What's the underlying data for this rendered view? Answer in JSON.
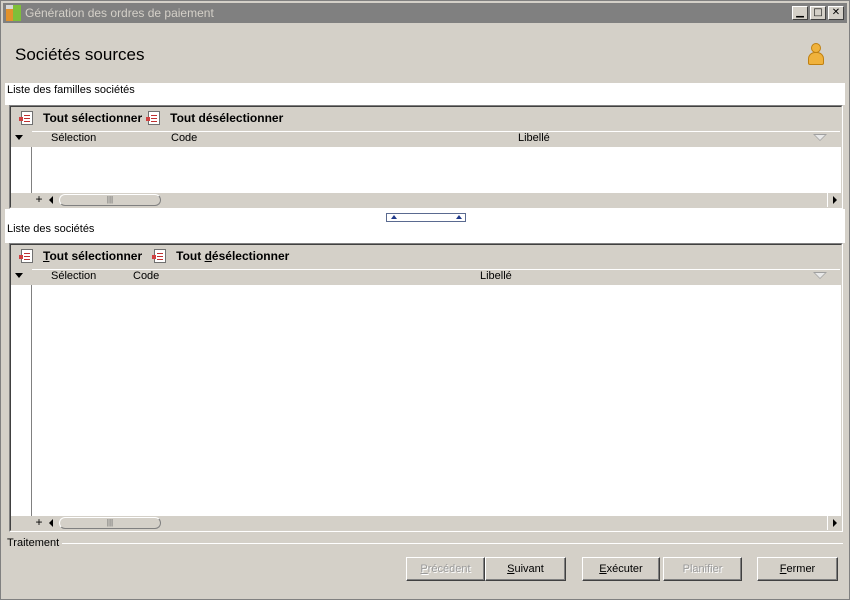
{
  "window": {
    "title": "Génération des ordres de paiement",
    "controls": {
      "minimize": "▁",
      "maximize": "□",
      "close": "✕"
    }
  },
  "header": {
    "title": "Sociétés sources"
  },
  "families": {
    "group_label": "Liste des familles sociétés",
    "toolbar": {
      "select_all": "Tout sélectionner",
      "deselect_all": "Tout désélectionner"
    },
    "columns": {
      "selection": "Sélection",
      "code": "Code",
      "libelle": "Libellé"
    },
    "scroll": {
      "plus": "+",
      "thumb": "|||"
    }
  },
  "companies": {
    "group_label": "Liste des sociétés",
    "toolbar": {
      "select_all_first": "T",
      "select_all_rest": "out sélectionner",
      "deselect_all_first": "Tout ",
      "deselect_all_accel": "d",
      "deselect_all_rest": "ésélectionner"
    },
    "columns": {
      "selection": "Sélection",
      "code": "Code",
      "libelle": "Libellé"
    },
    "scroll": {
      "plus": "+",
      "thumb": "|||"
    }
  },
  "footer": {
    "group_label": "Traitement",
    "buttons": {
      "precedent": {
        "accel": "P",
        "rest": "récédent",
        "enabled": false
      },
      "suivant": {
        "accel": "S",
        "rest": "uivant",
        "enabled": true
      },
      "executer": {
        "accel": "E",
        "rest": "xécuter",
        "enabled": true
      },
      "planifier": {
        "accel": "",
        "rest": "Planifier",
        "enabled": false
      },
      "fermer": {
        "accel": "F",
        "rest": "ermer",
        "enabled": true
      }
    }
  },
  "colors": {
    "titlebar": "#808080",
    "face": "#d4d0c8",
    "splitter_border": "#5a6a90"
  }
}
